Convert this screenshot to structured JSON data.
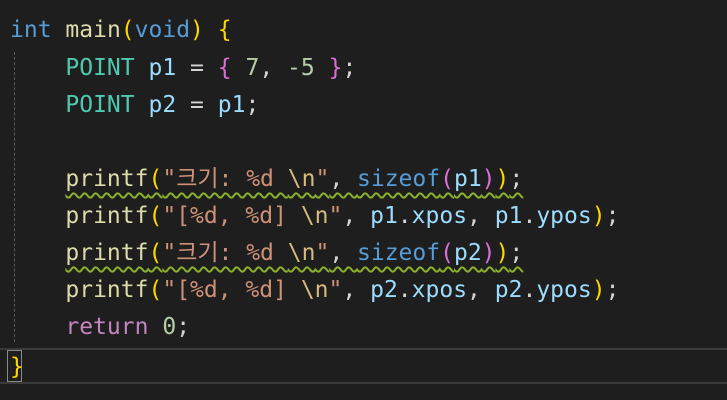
{
  "code": {
    "line1": {
      "kw_int": "int",
      "fn_main": "main",
      "open_paren": "(",
      "kw_void": "void",
      "close_paren": ")",
      "space": " ",
      "open_brace": "{"
    },
    "line2": {
      "indent": "    ",
      "type": "POINT",
      "sp1": " ",
      "var": "p1",
      "eq": " = ",
      "open": "{",
      "sp2": " ",
      "n1": "7",
      "comma": ", ",
      "n2": "-5",
      "sp3": " ",
      "close": "}",
      "semi": ";"
    },
    "line3": {
      "indent": "    ",
      "type": "POINT",
      "sp1": " ",
      "var": "p2",
      "eq": " = ",
      "rhs": "p1",
      "semi": ";"
    },
    "line5": {
      "indent": "    ",
      "fn": "printf",
      "open": "(",
      "str1": "\"크기: %d ",
      "esc": "\\n",
      "str2": "\"",
      "comma": ", ",
      "kw": "sizeof",
      "open2": "(",
      "arg": "p1",
      "close2": ")",
      "close": ")",
      "semi": ";"
    },
    "line6": {
      "indent": "    ",
      "fn": "printf",
      "open": "(",
      "str1": "\"[%d, %d] ",
      "esc": "\\n",
      "str2": "\"",
      "comma1": ", ",
      "obj1": "p1",
      "dot1": ".",
      "field1": "xpos",
      "comma2": ", ",
      "obj2": "p1",
      "dot2": ".",
      "field2": "ypos",
      "close": ")",
      "semi": ";"
    },
    "line7": {
      "indent": "    ",
      "fn": "printf",
      "open": "(",
      "str1": "\"크기: %d ",
      "esc": "\\n",
      "str2": "\"",
      "comma": ", ",
      "kw": "sizeof",
      "open2": "(",
      "arg": "p2",
      "close2": ")",
      "close": ")",
      "semi": ";"
    },
    "line8": {
      "indent": "    ",
      "fn": "printf",
      "open": "(",
      "str1": "\"[%d, %d] ",
      "esc": "\\n",
      "str2": "\"",
      "comma1": ", ",
      "obj1": "p2",
      "dot1": ".",
      "field1": "xpos",
      "comma2": ", ",
      "obj2": "p2",
      "dot2": ".",
      "field2": "ypos",
      "close": ")",
      "semi": ";"
    },
    "line9": {
      "indent": "    ",
      "kw": "return",
      "sp": " ",
      "num": "0",
      "semi": ";"
    },
    "line10": {
      "close_brace": "}"
    }
  }
}
